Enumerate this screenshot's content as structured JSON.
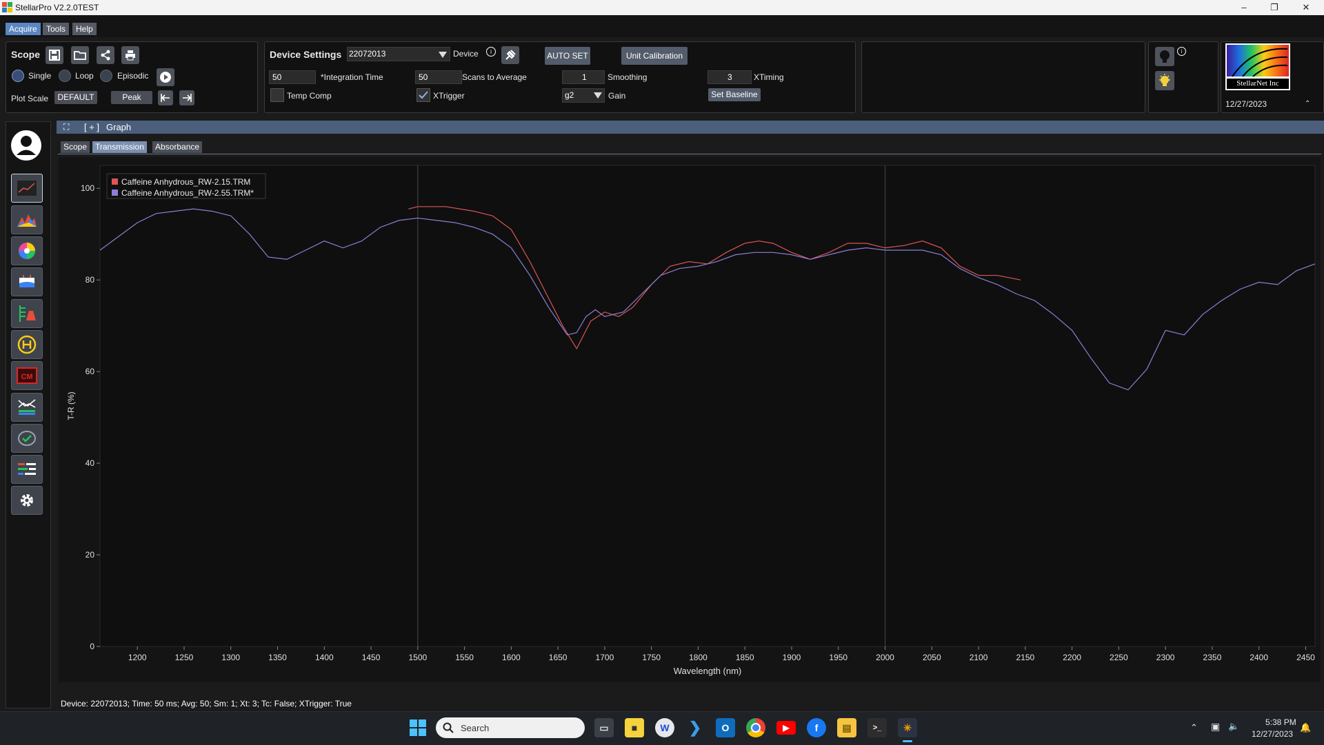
{
  "window": {
    "title": "StellarPro V2.2.0TEST"
  },
  "menu": [
    "Acquire",
    "Tools",
    "Help"
  ],
  "scope": {
    "title": "Scope",
    "modes": [
      "Single",
      "Loop",
      "Episodic"
    ],
    "plot_scale_label": "Plot Scale",
    "plot_scale_value": "DEFAULT",
    "peak_label": "Peak"
  },
  "device": {
    "title": "Device Settings",
    "device_id": "22072013",
    "device_label": "Device",
    "auto_set": "AUTO SET",
    "unit_calibration": "Unit Calibration",
    "integration_time_value": "50",
    "integration_time_label": "*Integration Time",
    "scans_value": "50",
    "scans_label": "Scans to Average",
    "smoothing_value": "1",
    "smoothing_label": "Smoothing",
    "xtiming_value": "3",
    "xtiming_label": "XTiming",
    "temp_comp_label": "Temp Comp",
    "xtrigger_label": "XTrigger",
    "gain_value": "g2",
    "gain_label": "Gain",
    "set_baseline": "Set Baseline"
  },
  "logo": {
    "text": "StellarNet Inc",
    "date": "12/27/2023"
  },
  "graph": {
    "header_expand": "[ + ]",
    "header_title": "Graph",
    "tabs": [
      "Scope",
      "Transmission",
      "Absorbance"
    ],
    "active_tab": "Transmission"
  },
  "chart_data": {
    "type": "line",
    "xlabel": "Wavelength (nm)",
    "ylabel": "T-R (%)",
    "xlim": [
      1160,
      2460
    ],
    "ylim": [
      0,
      105
    ],
    "xticks": [
      1200,
      1250,
      1300,
      1350,
      1400,
      1450,
      1500,
      1550,
      1600,
      1650,
      1700,
      1750,
      1800,
      1850,
      1900,
      1950,
      2000,
      2050,
      2100,
      2150,
      2200,
      2250,
      2300,
      2350,
      2400,
      2450
    ],
    "yticks": [
      0,
      20,
      40,
      60,
      80,
      100
    ],
    "legend_position": "top-left",
    "series": [
      {
        "name": "Caffeine Anhydrous_RW-2.15.TRM",
        "color": "#e05555",
        "x": [
          1490,
          1500,
          1530,
          1560,
          1580,
          1600,
          1620,
          1640,
          1655,
          1670,
          1685,
          1700,
          1715,
          1730,
          1750,
          1770,
          1790,
          1810,
          1830,
          1850,
          1865,
          1880,
          1900,
          1920,
          1940,
          1960,
          1980,
          2000,
          2020,
          2040,
          2060,
          2080,
          2100,
          2120,
          2145
        ],
        "y": [
          95.5,
          96,
          96,
          95,
          94,
          91,
          84,
          76,
          70,
          65,
          71,
          73,
          72,
          74,
          79,
          83,
          84,
          83.5,
          86,
          88,
          88.5,
          88,
          86,
          84.5,
          86,
          88,
          88,
          87,
          87.5,
          88.5,
          87,
          83,
          81,
          81,
          80
        ]
      },
      {
        "name": "Caffeine Anhydrous_RW-2.55.TRM*",
        "color": "#8b80d8",
        "x": [
          1160,
          1180,
          1200,
          1220,
          1240,
          1260,
          1280,
          1300,
          1320,
          1340,
          1360,
          1380,
          1400,
          1420,
          1440,
          1460,
          1480,
          1500,
          1520,
          1540,
          1560,
          1580,
          1600,
          1620,
          1640,
          1660,
          1670,
          1680,
          1690,
          1700,
          1720,
          1740,
          1760,
          1780,
          1800,
          1820,
          1840,
          1860,
          1880,
          1900,
          1920,
          1940,
          1960,
          1980,
          2000,
          2020,
          2040,
          2060,
          2080,
          2100,
          2120,
          2140,
          2160,
          2180,
          2200,
          2220,
          2240,
          2260,
          2280,
          2300,
          2320,
          2340,
          2360,
          2380,
          2400,
          2420,
          2440,
          2460
        ],
        "y": [
          86.5,
          89.5,
          92.5,
          94.5,
          95,
          95.5,
          95,
          94,
          90,
          85,
          84.5,
          86.5,
          88.5,
          87,
          88.5,
          91.5,
          93,
          93.5,
          93,
          92.5,
          91.5,
          90,
          87,
          81,
          74,
          68,
          68.5,
          72,
          73.5,
          72,
          73,
          77,
          81,
          82.5,
          83,
          84,
          85.5,
          86,
          86,
          85.5,
          84.5,
          85.5,
          86.5,
          87,
          86.5,
          86.5,
          86.5,
          85.5,
          82.5,
          80.5,
          79,
          77,
          75.5,
          72.5,
          69,
          63,
          57.5,
          56,
          60.5,
          69,
          68,
          72.5,
          75.5,
          78,
          79.5,
          79,
          82,
          83.5
        ]
      }
    ]
  },
  "status": "Device: 22072013; Time: 50 ms; Avg: 50; Sm: 1; Xt: 3; Tc: False; XTrigger: True",
  "taskbar": {
    "search_placeholder": "Search",
    "time": "5:38 PM",
    "date": "12/27/2023"
  }
}
